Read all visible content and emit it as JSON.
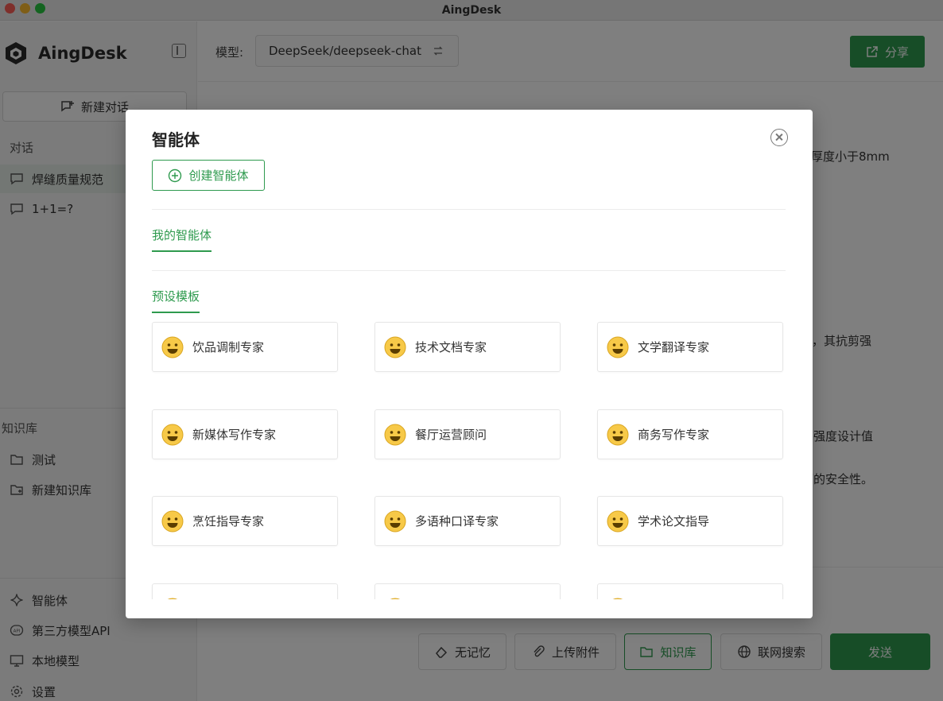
{
  "window": {
    "title": "AingDesk"
  },
  "sidebar": {
    "brand": "AingDesk",
    "new_chat_label": "新建对话",
    "conversations_label": "对话",
    "conversations": [
      {
        "label": "焊缝质量规范",
        "active": true
      },
      {
        "label": "1+1=?",
        "active": false
      }
    ],
    "knowledge_label": "知识库",
    "knowledge_items": [
      {
        "label": "测试"
      },
      {
        "label": "新建知识库"
      }
    ],
    "bottom_nav": [
      {
        "label": "智能体",
        "icon": "sparkle-icon"
      },
      {
        "label": "第三方模型API",
        "icon": "api-icon"
      },
      {
        "label": "本地模型",
        "icon": "monitor-icon"
      },
      {
        "label": "设置",
        "icon": "gear-icon"
      }
    ]
  },
  "header": {
    "model_label": "模型:",
    "model_value": "DeepSeek/deepseek-chat",
    "share_label": "分享"
  },
  "background_text": [
    "厚度小于8mm",
    "材，其抗剪强",
    "剪强度设计值",
    "下的安全性。"
  ],
  "toolbar": {
    "no_memory": "无记忆",
    "upload": "上传附件",
    "knowledge": "知识库",
    "web_search": "联网搜索",
    "send": "发送"
  },
  "dialog": {
    "title": "智能体",
    "create_label": "创建智能体",
    "my_agents_tab": "我的智能体",
    "presets_tab": "预设模板",
    "agents": [
      "饮品调制专家",
      "技术文档专家",
      "文学翻译专家",
      "新媒体写作专家",
      "餐厅运营顾问",
      "商务写作专家",
      "烹饪指导专家",
      "多语种口译专家",
      "学术论文指导",
      "",
      "",
      ""
    ]
  },
  "colors": {
    "accent": "#2e9a4e",
    "active_bg": "#e6efe8"
  }
}
